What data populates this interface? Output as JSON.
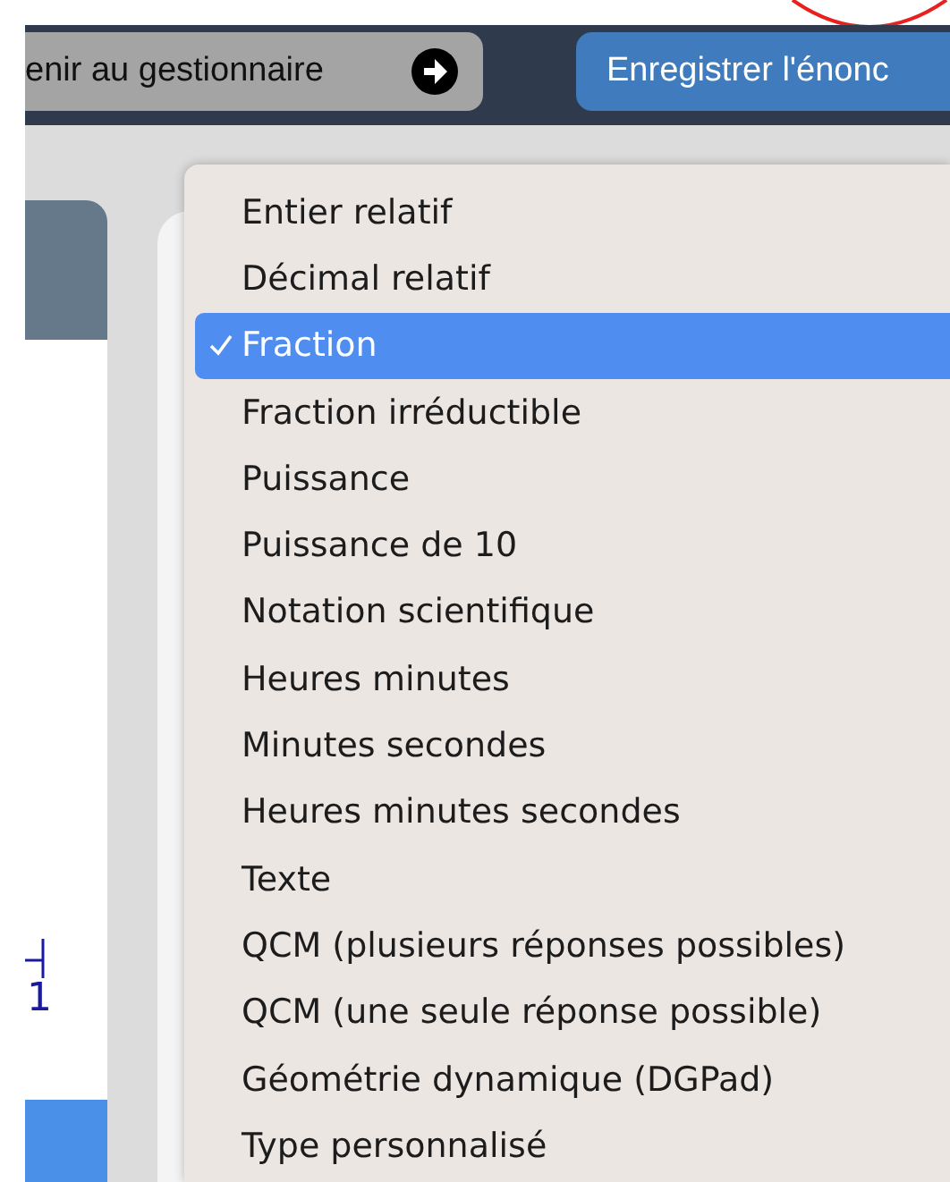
{
  "toolbar": {
    "back_button": {
      "label": "enir au gestionnaire"
    },
    "save_button": {
      "label": "Enregistrer l'énonc"
    }
  },
  "left_panel": {
    "digit": "1"
  },
  "dropdown_menu": {
    "items": [
      {
        "label": "Entier relatif",
        "selected": false
      },
      {
        "label": "Décimal relatif",
        "selected": false
      },
      {
        "label": "Fraction",
        "selected": true
      },
      {
        "label": "Fraction irréductible",
        "selected": false
      },
      {
        "label": "Puissance",
        "selected": false
      },
      {
        "label": "Puissance de 10",
        "selected": false
      },
      {
        "label": "Notation scientifique",
        "selected": false
      },
      {
        "label": "Heures minutes",
        "selected": false
      },
      {
        "label": "Minutes secondes",
        "selected": false
      },
      {
        "label": "Heures minutes secondes",
        "selected": false
      },
      {
        "label": "Texte",
        "selected": false
      },
      {
        "label": "QCM (plusieurs réponses possibles)",
        "selected": false
      },
      {
        "label": "QCM (une seule réponse possible)",
        "selected": false
      },
      {
        "label": "Géométrie dynamique (DGPad)",
        "selected": false
      },
      {
        "label": "Type personnalisé",
        "selected": false
      }
    ]
  }
}
